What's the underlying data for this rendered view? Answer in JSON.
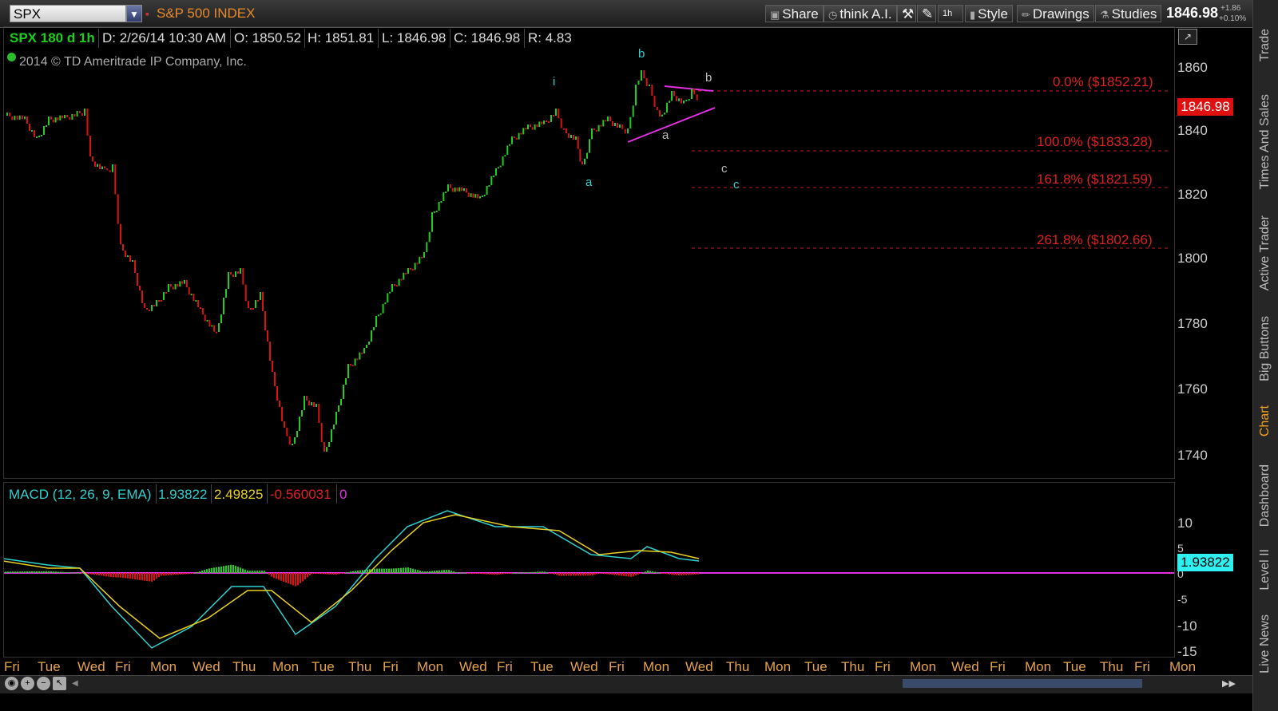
{
  "toolbar": {
    "symbol": "SPX",
    "index_name": "S&P 500 INDEX",
    "share": "Share",
    "think": "think A.I.",
    "interval": "1h",
    "style": "Style",
    "drawings": "Drawings",
    "studies": "Studies",
    "last": "1846.98",
    "change": "+1.86",
    "change_pct": "+0.10%"
  },
  "header": {
    "symbol": "SPX 180 d 1h",
    "date": "D: 2/26/14 10:30 AM",
    "open": "O: 1850.52",
    "high": "H: 1851.81",
    "low": "L: 1846.98",
    "close": "C: 1846.98",
    "range": "R: 4.83",
    "copyright": "2014 © TD Ameritrade IP Company, Inc."
  },
  "price_axis": [
    "1860",
    "1840",
    "1820",
    "1800",
    "1780",
    "1760",
    "1740"
  ],
  "price_tag": "1846.98",
  "fib": [
    {
      "label": "0.0%  ($1852.21)"
    },
    {
      "label": "100.0%  ($1833.28)"
    },
    {
      "label": "161.8%  ($1821.59)"
    },
    {
      "label": "261.8%  ($1802.66)"
    }
  ],
  "waves": {
    "i": "i",
    "b1": "b",
    "a1": "a",
    "b2": "b",
    "a2": "a",
    "c1": "c",
    "c2": "c"
  },
  "macd": {
    "label": "MACD (12, 26, 9, EMA)",
    "value": "1.93822",
    "avg": "2.49825",
    "diff": "-0.560031",
    "zero": "0",
    "axis": [
      "10",
      "5",
      "0",
      "-5",
      "-10",
      "-15"
    ],
    "tag": "1.93822"
  },
  "days": [
    "Fri",
    "Tue",
    "Wed",
    "Fri",
    "Mon",
    "Wed",
    "Thu",
    "Mon",
    "Tue",
    "Thu",
    "Fri",
    "Mon",
    "Wed",
    "Fri",
    "Tue",
    "Wed",
    "Fri",
    "Mon",
    "Wed",
    "Thu",
    "Mon",
    "Tue",
    "Thu",
    "Fri",
    "Mon",
    "Wed",
    "Fri",
    "Mon",
    "Tue",
    "Thu",
    "Fri",
    "Mon"
  ],
  "side_tabs": [
    "Trade",
    "Times And Sales",
    "Active Trader",
    "Big Buttons",
    "Chart",
    "Dashboard",
    "Level II",
    "Live News"
  ],
  "colors": {
    "up": "#22cc22",
    "down": "#dd1111",
    "macd": "#2ed0d0",
    "signal": "#e8d020",
    "fib": "#e02020",
    "accent": "#e88a2a"
  }
}
